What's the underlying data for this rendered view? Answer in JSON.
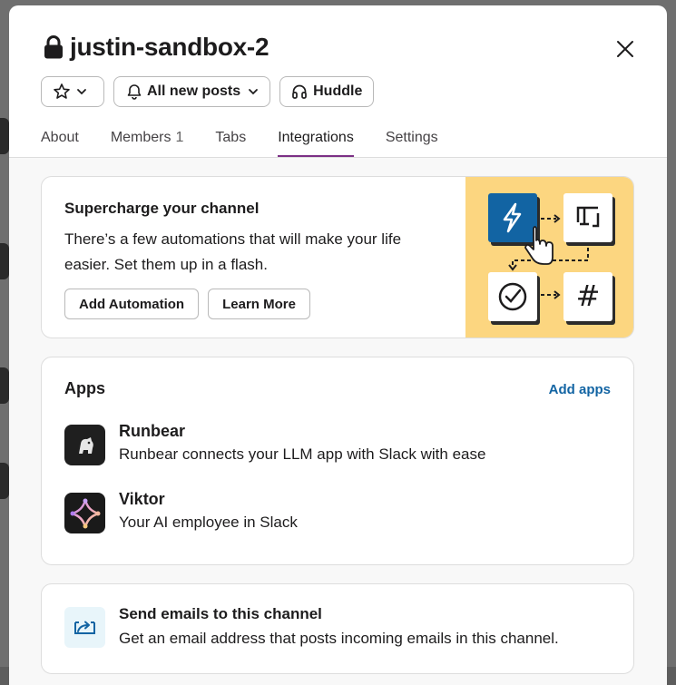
{
  "channel": {
    "name": "justin-sandbox-2"
  },
  "header_buttons": {
    "notifications_label": "All new posts",
    "huddle_label": "Huddle"
  },
  "tabs": [
    {
      "label": "About"
    },
    {
      "label": "Members",
      "count": "1"
    },
    {
      "label": "Tabs"
    },
    {
      "label": "Integrations",
      "active": true
    },
    {
      "label": "Settings"
    }
  ],
  "supercharge": {
    "title": "Supercharge your channel",
    "description": "There’s a few automations that will make your life easier. Set them up in a flash.",
    "add_automation_label": "Add Automation",
    "learn_more_label": "Learn More"
  },
  "apps": {
    "title": "Apps",
    "add_label": "Add apps",
    "items": [
      {
        "name": "Runbear",
        "description": "Runbear connects your LLM app with Slack with ease",
        "icon": "runbear-logo"
      },
      {
        "name": "Viktor",
        "description": "Your AI employee in Slack",
        "icon": "viktor-logo"
      }
    ]
  },
  "email": {
    "title": "Send emails to this channel",
    "description": "Get an email address that posts incoming emails in this channel."
  },
  "colors": {
    "accent_tab": "#7c3085",
    "link": "#1264a3",
    "illustration_bg": "#fcd680",
    "bolt_tile": "#1264a3"
  }
}
